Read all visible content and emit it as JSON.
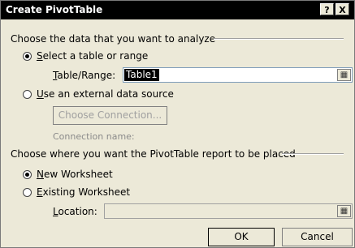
{
  "window": {
    "title": "Create PivotTable",
    "help_label": "?",
    "close_label": "X"
  },
  "section_data": {
    "heading": "Choose the data that you want to analyze",
    "option_table": {
      "label_mnemonic": "S",
      "label_rest": "elect a table or range",
      "selected": true
    },
    "table_range": {
      "label_mnemonic": "T",
      "label_rest": "able/Range:",
      "value": "Table1"
    },
    "option_external": {
      "label_mnemonic": "U",
      "label_rest": "se an external data source",
      "selected": false
    },
    "choose_connection_label": "Choose Connection...",
    "connection_name_label": "Connection name:"
  },
  "section_placement": {
    "heading": "Choose where you want the PivotTable report to be placed",
    "option_new": {
      "label_mnemonic": "N",
      "label_rest": "ew Worksheet",
      "selected": true
    },
    "option_existing": {
      "label_mnemonic": "E",
      "label_rest": "xisting Worksheet",
      "selected": false
    },
    "location": {
      "label_mnemonic": "L",
      "label_rest": "ocation:",
      "value": ""
    }
  },
  "buttons": {
    "ok_label": "OK",
    "cancel_label": "Cancel"
  },
  "icons": {
    "range_picker": "collapse-dialog-icon"
  }
}
